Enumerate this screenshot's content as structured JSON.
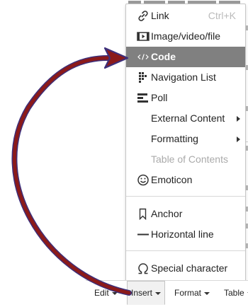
{
  "menu": {
    "items": [
      {
        "label": "Link",
        "shortcut": "Ctrl+K",
        "icon": "link-icon"
      },
      {
        "label": "Image/video/file",
        "icon": "media-icon"
      },
      {
        "label": "Code",
        "icon": "code-icon",
        "state": "highlighted"
      },
      {
        "label": "Navigation List",
        "icon": "navigation-list-icon"
      },
      {
        "label": "Poll",
        "icon": "poll-icon"
      },
      {
        "label": "External Content",
        "submenu": true
      },
      {
        "label": "Formatting",
        "submenu": true
      },
      {
        "label": "Table of Contents",
        "state": "disabled"
      },
      {
        "label": "Emoticon",
        "icon": "emoticon-icon"
      },
      {
        "label": "Anchor",
        "icon": "bookmark-icon"
      },
      {
        "label": "Horizontal line",
        "icon": "horizontal-line-icon"
      },
      {
        "label": "Special character",
        "icon": "omega-icon"
      }
    ]
  },
  "toolbar": {
    "edit_label": "Edit",
    "insert_label": "Insert",
    "format_label": "Format",
    "table_label": "Table"
  },
  "colors": {
    "highlight_bg": "#808080",
    "annotation_arrow": "#8b1a1a",
    "annotation_outline": "#3d2f7a"
  }
}
